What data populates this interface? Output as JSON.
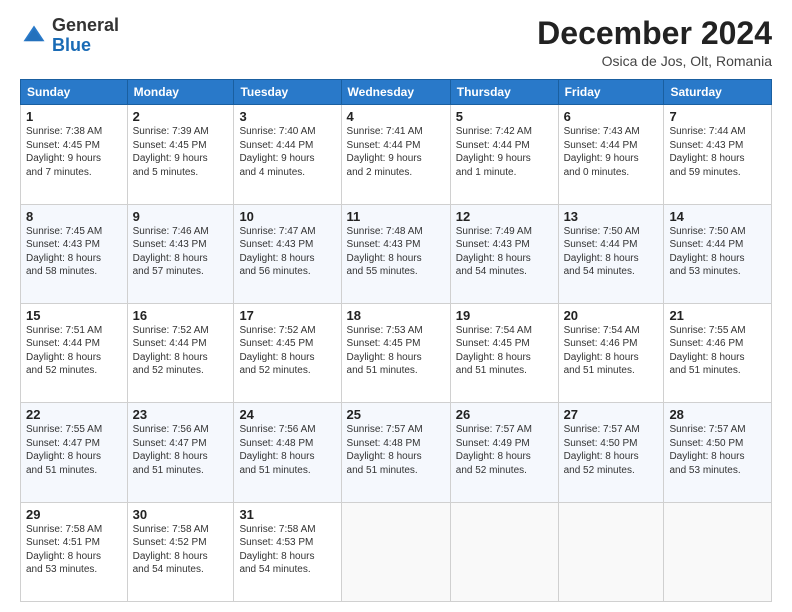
{
  "header": {
    "logo_general": "General",
    "logo_blue": "Blue",
    "month_title": "December 2024",
    "location": "Osica de Jos, Olt, Romania"
  },
  "days_of_week": [
    "Sunday",
    "Monday",
    "Tuesday",
    "Wednesday",
    "Thursday",
    "Friday",
    "Saturday"
  ],
  "weeks": [
    [
      {
        "day": "1",
        "info": "Sunrise: 7:38 AM\nSunset: 4:45 PM\nDaylight: 9 hours\nand 7 minutes."
      },
      {
        "day": "2",
        "info": "Sunrise: 7:39 AM\nSunset: 4:45 PM\nDaylight: 9 hours\nand 5 minutes."
      },
      {
        "day": "3",
        "info": "Sunrise: 7:40 AM\nSunset: 4:44 PM\nDaylight: 9 hours\nand 4 minutes."
      },
      {
        "day": "4",
        "info": "Sunrise: 7:41 AM\nSunset: 4:44 PM\nDaylight: 9 hours\nand 2 minutes."
      },
      {
        "day": "5",
        "info": "Sunrise: 7:42 AM\nSunset: 4:44 PM\nDaylight: 9 hours\nand 1 minute."
      },
      {
        "day": "6",
        "info": "Sunrise: 7:43 AM\nSunset: 4:44 PM\nDaylight: 9 hours\nand 0 minutes."
      },
      {
        "day": "7",
        "info": "Sunrise: 7:44 AM\nSunset: 4:43 PM\nDaylight: 8 hours\nand 59 minutes."
      }
    ],
    [
      {
        "day": "8",
        "info": "Sunrise: 7:45 AM\nSunset: 4:43 PM\nDaylight: 8 hours\nand 58 minutes."
      },
      {
        "day": "9",
        "info": "Sunrise: 7:46 AM\nSunset: 4:43 PM\nDaylight: 8 hours\nand 57 minutes."
      },
      {
        "day": "10",
        "info": "Sunrise: 7:47 AM\nSunset: 4:43 PM\nDaylight: 8 hours\nand 56 minutes."
      },
      {
        "day": "11",
        "info": "Sunrise: 7:48 AM\nSunset: 4:43 PM\nDaylight: 8 hours\nand 55 minutes."
      },
      {
        "day": "12",
        "info": "Sunrise: 7:49 AM\nSunset: 4:43 PM\nDaylight: 8 hours\nand 54 minutes."
      },
      {
        "day": "13",
        "info": "Sunrise: 7:50 AM\nSunset: 4:44 PM\nDaylight: 8 hours\nand 54 minutes."
      },
      {
        "day": "14",
        "info": "Sunrise: 7:50 AM\nSunset: 4:44 PM\nDaylight: 8 hours\nand 53 minutes."
      }
    ],
    [
      {
        "day": "15",
        "info": "Sunrise: 7:51 AM\nSunset: 4:44 PM\nDaylight: 8 hours\nand 52 minutes."
      },
      {
        "day": "16",
        "info": "Sunrise: 7:52 AM\nSunset: 4:44 PM\nDaylight: 8 hours\nand 52 minutes."
      },
      {
        "day": "17",
        "info": "Sunrise: 7:52 AM\nSunset: 4:45 PM\nDaylight: 8 hours\nand 52 minutes."
      },
      {
        "day": "18",
        "info": "Sunrise: 7:53 AM\nSunset: 4:45 PM\nDaylight: 8 hours\nand 51 minutes."
      },
      {
        "day": "19",
        "info": "Sunrise: 7:54 AM\nSunset: 4:45 PM\nDaylight: 8 hours\nand 51 minutes."
      },
      {
        "day": "20",
        "info": "Sunrise: 7:54 AM\nSunset: 4:46 PM\nDaylight: 8 hours\nand 51 minutes."
      },
      {
        "day": "21",
        "info": "Sunrise: 7:55 AM\nSunset: 4:46 PM\nDaylight: 8 hours\nand 51 minutes."
      }
    ],
    [
      {
        "day": "22",
        "info": "Sunrise: 7:55 AM\nSunset: 4:47 PM\nDaylight: 8 hours\nand 51 minutes."
      },
      {
        "day": "23",
        "info": "Sunrise: 7:56 AM\nSunset: 4:47 PM\nDaylight: 8 hours\nand 51 minutes."
      },
      {
        "day": "24",
        "info": "Sunrise: 7:56 AM\nSunset: 4:48 PM\nDaylight: 8 hours\nand 51 minutes."
      },
      {
        "day": "25",
        "info": "Sunrise: 7:57 AM\nSunset: 4:48 PM\nDaylight: 8 hours\nand 51 minutes."
      },
      {
        "day": "26",
        "info": "Sunrise: 7:57 AM\nSunset: 4:49 PM\nDaylight: 8 hours\nand 52 minutes."
      },
      {
        "day": "27",
        "info": "Sunrise: 7:57 AM\nSunset: 4:50 PM\nDaylight: 8 hours\nand 52 minutes."
      },
      {
        "day": "28",
        "info": "Sunrise: 7:57 AM\nSunset: 4:50 PM\nDaylight: 8 hours\nand 53 minutes."
      }
    ],
    [
      {
        "day": "29",
        "info": "Sunrise: 7:58 AM\nSunset: 4:51 PM\nDaylight: 8 hours\nand 53 minutes."
      },
      {
        "day": "30",
        "info": "Sunrise: 7:58 AM\nSunset: 4:52 PM\nDaylight: 8 hours\nand 54 minutes."
      },
      {
        "day": "31",
        "info": "Sunrise: 7:58 AM\nSunset: 4:53 PM\nDaylight: 8 hours\nand 54 minutes."
      },
      {
        "day": "",
        "info": ""
      },
      {
        "day": "",
        "info": ""
      },
      {
        "day": "",
        "info": ""
      },
      {
        "day": "",
        "info": ""
      }
    ]
  ]
}
